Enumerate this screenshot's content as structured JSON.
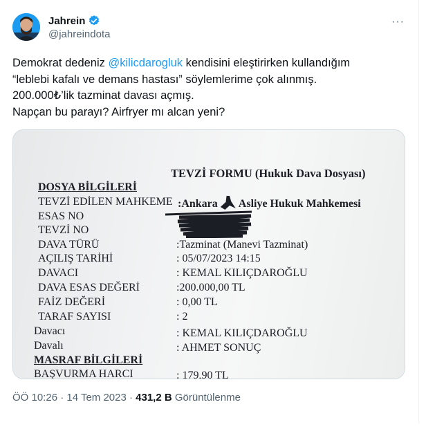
{
  "tweet": {
    "author_name": "Jahrein",
    "author_handle": "@jahreindota",
    "more_label": "···",
    "text_before": "Demokrat dedeniz ",
    "mention": "@kilicdarogluk",
    "text_after": " kendisini eleştirirken kullandığım\n“leblebi kafalı ve demans hastası” söylemlerime çok alınmış.\n200.000₺’lik tazminat davası açmış.\nNapçan bu parayı? Airfryer mı alcan yeni?",
    "time": "ÖÖ 10:26 · 14 Tem 2023 · ",
    "views_count": "431,2 B",
    "views_label": " Görüntülenme"
  },
  "document": {
    "form_title": "TEVZİ FORMU (Hukuk Dava Dosyası)",
    "section1": "DOSYA BİLGİLERİ",
    "section2": "MASRAF BİLGİLERİ",
    "labels": {
      "court": "TEVZİ EDİLEN MAHKEME",
      "esas_no": "ESAS NO",
      "tevzi_no": "TEVZİ NO",
      "case_type": "DAVA TÜRÜ",
      "open_date": "AÇILIŞ TARİHİ",
      "plaintiff": "DAVACI",
      "case_value": "DAVA ESAS DEĞERİ",
      "interest": "FAİZ DEĞERİ",
      "party_count": "TARAF SAYISI",
      "plaintiff2": "Davacı",
      "defendant": "Davalı",
      "application_fee": "BAŞVURMA HARCI"
    },
    "values": {
      "court": ":Ankara",
      "court_suffix": "Asliye Hukuk Mahkemesi",
      "case_type": ":Tazminat (Manevi Tazminat)",
      "open_date": ": 05/07/2023  14:15",
      "plaintiff": ": KEMAL KILIÇDAROĞLU",
      "case_value": ":200.000,00 TL",
      "interest": ": 0,00 TL",
      "party_count": ": 2",
      "plaintiff2": ": KEMAL KILIÇDAROĞLU",
      "defendant": ": AHMET SONUÇ",
      "application_fee": ": 179,90 TL"
    }
  },
  "colors": {
    "accent": "#1d9bf0",
    "muted": "#536471",
    "text": "#0f1419"
  }
}
